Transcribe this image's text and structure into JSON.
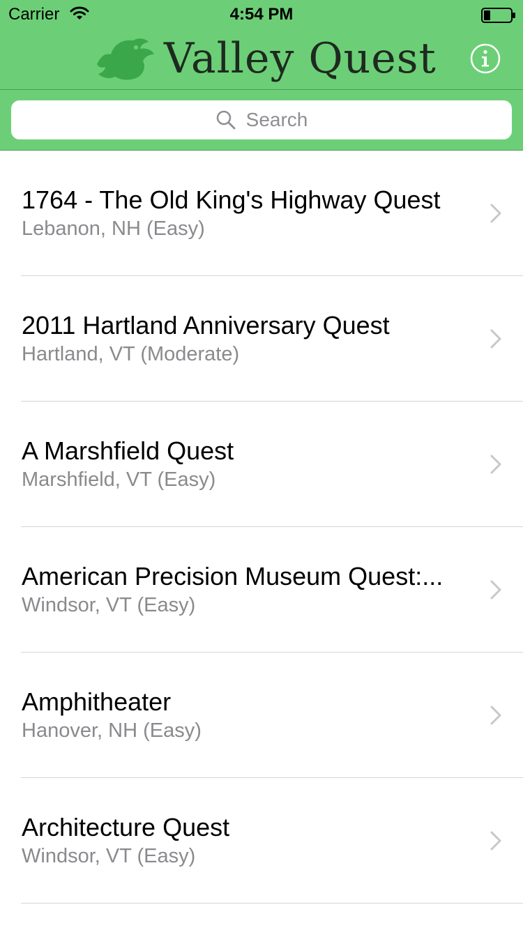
{
  "status_bar": {
    "carrier": "Carrier",
    "time": "4:54 PM",
    "wifi_icon": "wifi-icon",
    "battery_icon": "battery-low-icon"
  },
  "nav": {
    "logo_text": "Valley Quest",
    "logo_icon": "bird-logo-icon",
    "info_icon": "info-icon"
  },
  "search": {
    "placeholder": "Search",
    "icon": "search-icon"
  },
  "colors": {
    "header_green": "#6ccf77",
    "logo_green": "#3aa84a",
    "subtitle_gray": "#8a8a8e",
    "chevron_gray": "#c7c7cc"
  },
  "quests": [
    {
      "title": "1764 - The Old King's Highway Quest",
      "subtitle": "Lebanon, NH (Easy)"
    },
    {
      "title": "2011 Hartland Anniversary Quest",
      "subtitle": "Hartland, VT (Moderate)"
    },
    {
      "title": "A Marshfield Quest",
      "subtitle": "Marshfield, VT (Easy)"
    },
    {
      "title": "American Precision Museum Quest:...",
      "subtitle": "Windsor, VT (Easy)"
    },
    {
      "title": "Amphitheater",
      "subtitle": "Hanover, NH (Easy)"
    },
    {
      "title": "Architecture Quest",
      "subtitle": "Windsor, VT (Easy)"
    }
  ]
}
